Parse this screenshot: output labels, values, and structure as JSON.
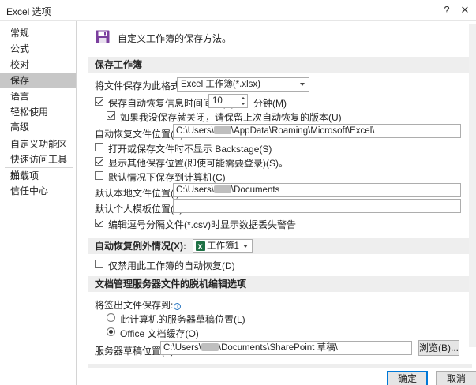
{
  "window": {
    "title": "Excel 选项",
    "help": "?",
    "close": "✕"
  },
  "sidebar": {
    "items": [
      {
        "label": "常规"
      },
      {
        "label": "公式"
      },
      {
        "label": "校对"
      },
      {
        "label": "保存"
      },
      {
        "label": "语言"
      },
      {
        "label": "轻松使用"
      },
      {
        "label": "高级"
      },
      {
        "label": "自定义功能区"
      },
      {
        "label": "快速访问工具栏"
      },
      {
        "label": "加载项"
      },
      {
        "label": "信任中心"
      }
    ]
  },
  "header": {
    "icon": "floppy-disk-icon",
    "text": "自定义工作簿的保存方法。"
  },
  "save_workbooks": {
    "heading": "保存工作簿",
    "format_label": "将文件保存为此格式(F):",
    "format_value": "Excel 工作簿(*.xlsx)",
    "autorecover_label": "保存自动恢复信息时间间隔(A)",
    "autorecover_checked": true,
    "autorecover_minutes": "10",
    "minutes_label": "分钟(M)",
    "keep_last_label": "如果我没保存就关闭，请保留上次自动恢复的版本(U)",
    "keep_last_checked": true,
    "autorecover_location_label": "自动恢复文件位置(R):",
    "autorecover_location_prefix": "C:\\Users\\",
    "autorecover_location_suffix": "\\AppData\\Roaming\\Microsoft\\Excel\\",
    "backstage_label": "打开或保存文件时不显示 Backstage(S)",
    "backstage_checked": false,
    "show_more_label": "显示其他保存位置(即使可能需要登录)(S)。",
    "show_more_checked": true,
    "default_computer_label": "默认情况下保存到计算机(C)",
    "default_computer_checked": false,
    "default_local_label": "默认本地文件位置(I):",
    "default_local_prefix": "C:\\Users\\",
    "default_local_suffix": "\\Documents",
    "template_label": "默认个人模板位置(T):",
    "template_value": "",
    "csv_warning_label": "编辑逗号分隔文件(*.csv)时显示数据丢失警告",
    "csv_warning_checked": true
  },
  "autorecover_exceptions": {
    "heading": "自动恢复例外情况(X):",
    "workbook_value": "工作簿1",
    "disable_label": "仅禁用此工作簿的自动恢复(D)",
    "disable_checked": false
  },
  "offline_editing": {
    "heading": "文档管理服务器文件的脱机编辑选项",
    "save_to_label": "将签出文件保存到:",
    "server_drafts_label": "此计算机的服务器草稿位置(L)",
    "office_cache_label": "Office 文档缓存(O)",
    "selected": "office_cache",
    "server_location_label": "服务器草稿位置(V):",
    "server_location_prefix": "C:\\Users\\",
    "server_location_suffix": "\\Documents\\SharePoint 草稿\\",
    "browse_label": "浏览(B)..."
  },
  "footer": {
    "ok_label": "确定",
    "cancel_label": "取消"
  }
}
